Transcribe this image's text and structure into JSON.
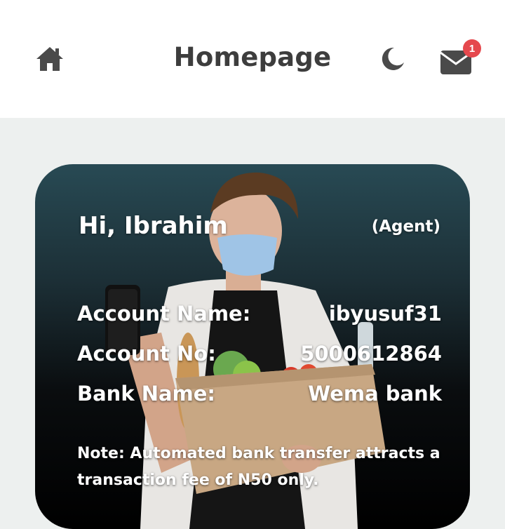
{
  "header": {
    "title": "Homepage",
    "home_icon": "home-icon",
    "theme_icon": "moon-icon",
    "mail_icon": "mail-icon",
    "mail_badge_count": "1"
  },
  "card": {
    "greeting": "Hi, Ibrahim",
    "role": "(Agent)",
    "account_name_label": "Account Name:",
    "account_name_value": "ibyusuf31",
    "account_no_label": "Account No:",
    "account_no_value": "5000612864",
    "bank_name_label": "Bank Name:",
    "bank_name_value": "Wema bank",
    "note": "Note: Automated bank transfer attracts a transaction fee of N50 only."
  },
  "colors": {
    "page_bg": "#edf0ef",
    "header_bg": "#ffffff",
    "title": "#3d3d3d",
    "badge": "#e5484d",
    "card_top": "#284a54",
    "card_bottom": "#000000"
  }
}
